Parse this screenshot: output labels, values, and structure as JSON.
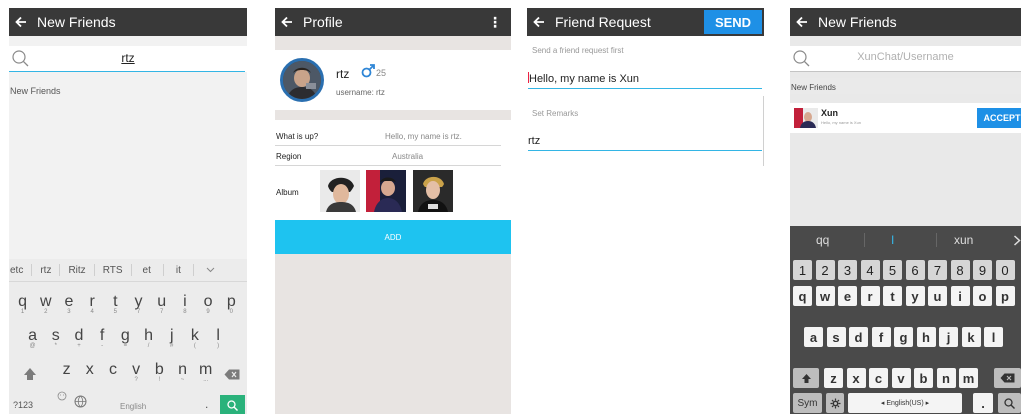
{
  "screen1": {
    "title": "New Friends",
    "search_query": "rtz",
    "section_label": "New Friends",
    "suggestions": [
      "etc",
      "rtz",
      "Ritz",
      "RTS",
      "et",
      "it"
    ],
    "row1": [
      {
        "k": "q",
        "s": "1"
      },
      {
        "k": "w",
        "s": "2"
      },
      {
        "k": "e",
        "s": "3"
      },
      {
        "k": "r",
        "s": "4"
      },
      {
        "k": "t",
        "s": "5"
      },
      {
        "k": "y",
        "s": "7"
      },
      {
        "k": "u",
        "s": "7"
      },
      {
        "k": "i",
        "s": "8"
      },
      {
        "k": "o",
        "s": "9"
      },
      {
        "k": "p",
        "s": "0"
      }
    ],
    "row2": [
      {
        "k": "a",
        "s": "@"
      },
      {
        "k": "s",
        "s": "*"
      },
      {
        "k": "d",
        "s": "+"
      },
      {
        "k": "f",
        "s": "-"
      },
      {
        "k": "g",
        "s": "="
      },
      {
        "k": "h",
        "s": "/"
      },
      {
        "k": "j",
        "s": "#"
      },
      {
        "k": "k",
        "s": "("
      },
      {
        "k": "l",
        "s": ")"
      }
    ],
    "row3": [
      {
        "k": "z",
        "s": ""
      },
      {
        "k": "x",
        "s": ""
      },
      {
        "k": "c",
        "s": ""
      },
      {
        "k": "v",
        "s": "?"
      },
      {
        "k": "b",
        "s": "!"
      },
      {
        "k": "n",
        "s": "~"
      },
      {
        "k": "m",
        "s": "..."
      }
    ],
    "mode_key": "?123",
    "space_label": "English",
    "period_key": "."
  },
  "screen2": {
    "title": "Profile",
    "name": "rtz",
    "age": "25",
    "username": "username: rtz",
    "whatsup_label": "What is up?",
    "whatsup_value": "Hello, my name is rtz.",
    "region_label": "Region",
    "region_value": "Australia",
    "album_label": "Album",
    "add_label": "ADD"
  },
  "screen3": {
    "title": "Friend Request",
    "send_label": "SEND",
    "hint1": "Send a friend request first",
    "message": "Hello, my name is Xun",
    "hint2": "Set Remarks",
    "remarks": "rtz"
  },
  "screen4": {
    "title": "New Friends",
    "search_placeholder": "XunChat/Username",
    "section_label": "New Friends",
    "request_name": "Xun",
    "request_message": "Hello, my name is Xun",
    "accept_label": "ACCEPT",
    "candidates": [
      "qq",
      "I",
      "xun"
    ],
    "numbers": [
      "1",
      "2",
      "3",
      "4",
      "5",
      "6",
      "7",
      "8",
      "9",
      "0"
    ],
    "row1": [
      "q",
      "w",
      "e",
      "r",
      "t",
      "y",
      "u",
      "i",
      "o",
      "p"
    ],
    "row2": [
      "a",
      "s",
      "d",
      "f",
      "g",
      "h",
      "j",
      "k",
      "l"
    ],
    "row3": [
      "z",
      "x",
      "c",
      "v",
      "b",
      "n",
      "m"
    ],
    "sym_key": "Sym",
    "lang_label": "◂ English(US) ▸",
    "period_key": "."
  },
  "colors": {
    "topbar": "#393939",
    "accent_blue": "#1e90e6",
    "add_cyan": "#1ec3f0",
    "focus_line": "#33b5e5"
  }
}
